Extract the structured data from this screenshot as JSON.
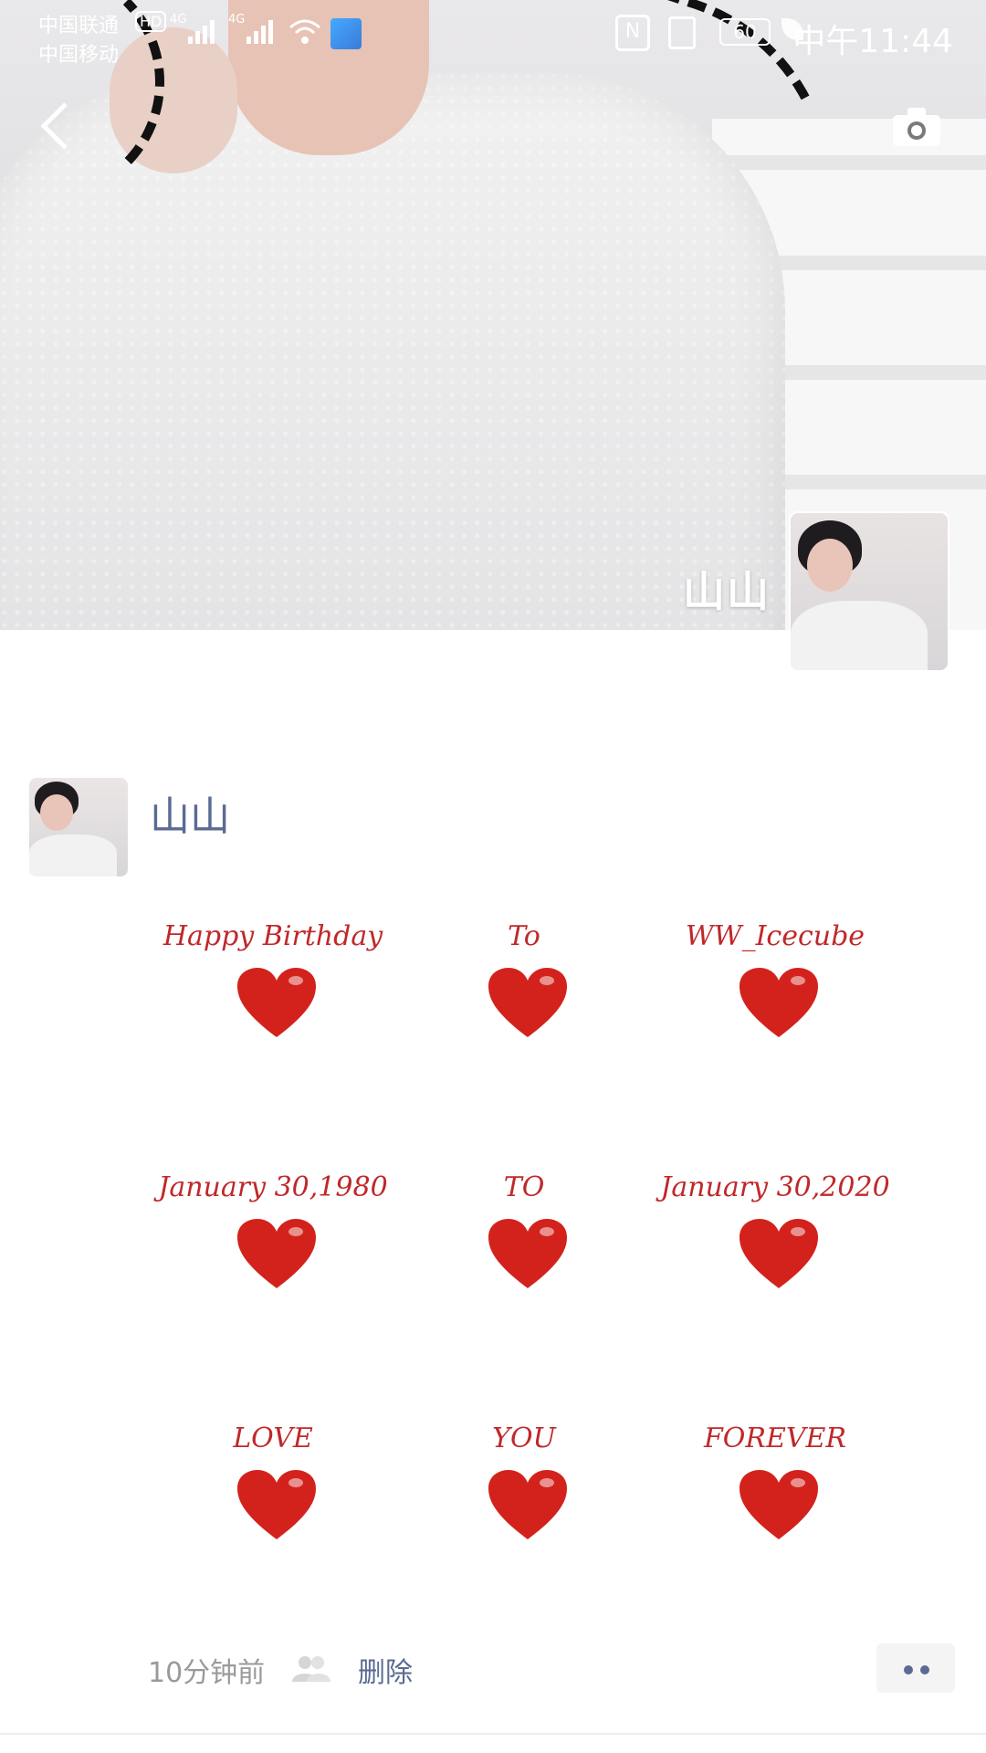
{
  "status_bar": {
    "carrier_1": "中国联通",
    "carrier_2": "中国移动",
    "hd_badge": "HD",
    "network_1": "4G",
    "network_2": "4G",
    "battery": "60",
    "time": "中午11:44",
    "icons": [
      "signal-icon",
      "wifi-icon",
      "nfc-icon",
      "vibrate-icon",
      "battery-icon",
      "leaf-icon",
      "app-notification-icon"
    ]
  },
  "header": {
    "back_icon": "chevron-left-icon",
    "camera_icon": "camera-icon",
    "cover_name": "山山"
  },
  "post": {
    "author": "山山",
    "card_cells": [
      {
        "text": "Happy Birthday"
      },
      {
        "text": "To"
      },
      {
        "text": "WW_Icecube"
      },
      {
        "text": "January 30,1980"
      },
      {
        "text": "TO"
      },
      {
        "text": "January 30,2020"
      },
      {
        "text": "LOVE"
      },
      {
        "text": "YOU"
      },
      {
        "text": "FOREVER"
      }
    ],
    "heart_color": "#d3221c",
    "text_color": "#c0282a"
  },
  "footer": {
    "time_ago": "10分钟前",
    "visibility_icon": "people-icon",
    "delete_label": "删除",
    "more_icon": "more-dots-icon"
  },
  "colors": {
    "link": "#5a6a92",
    "muted": "#9a9a9a"
  }
}
